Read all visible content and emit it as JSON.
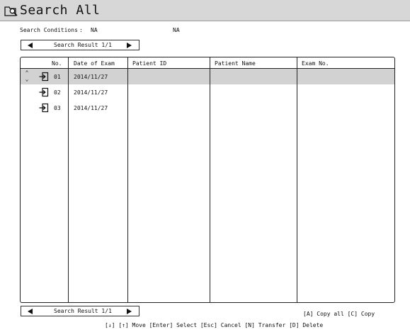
{
  "window": {
    "title": "Search All"
  },
  "conditions": {
    "label": "Search Conditions",
    "separator": ":",
    "value1": "NA",
    "value2": "NA"
  },
  "nav_top": {
    "label": "Search Result 1/1"
  },
  "nav_bottom": {
    "label": "Search Result 1/1"
  },
  "table": {
    "headers": [
      "No.",
      "Date of Exam",
      "Patient ID",
      "Patient Name",
      "Exam No."
    ],
    "rows": [
      {
        "no": "01",
        "date": "2014/11/27",
        "patient_id": "",
        "patient_name": "",
        "exam_no": "",
        "selected": true
      },
      {
        "no": "02",
        "date": "2014/11/27",
        "patient_id": "",
        "patient_name": "",
        "exam_no": "",
        "selected": false
      },
      {
        "no": "03",
        "date": "2014/11/27",
        "patient_id": "",
        "patient_name": "",
        "exam_no": "",
        "selected": false
      }
    ]
  },
  "shortcuts": {
    "right": "[A] Copy all  [C] Copy",
    "bottom": "[↓] [↑] Move  [Enter] Select  [Esc] Cancel  [N] Transfer  [D] Delete"
  },
  "icons": {
    "title": "search-folder-icon",
    "row": "import-arrow-icon",
    "selector": "up-down-chevron-icon"
  },
  "colors": {
    "titlebar": "#d7d7d7",
    "selected_row": "#d2d2d2"
  }
}
